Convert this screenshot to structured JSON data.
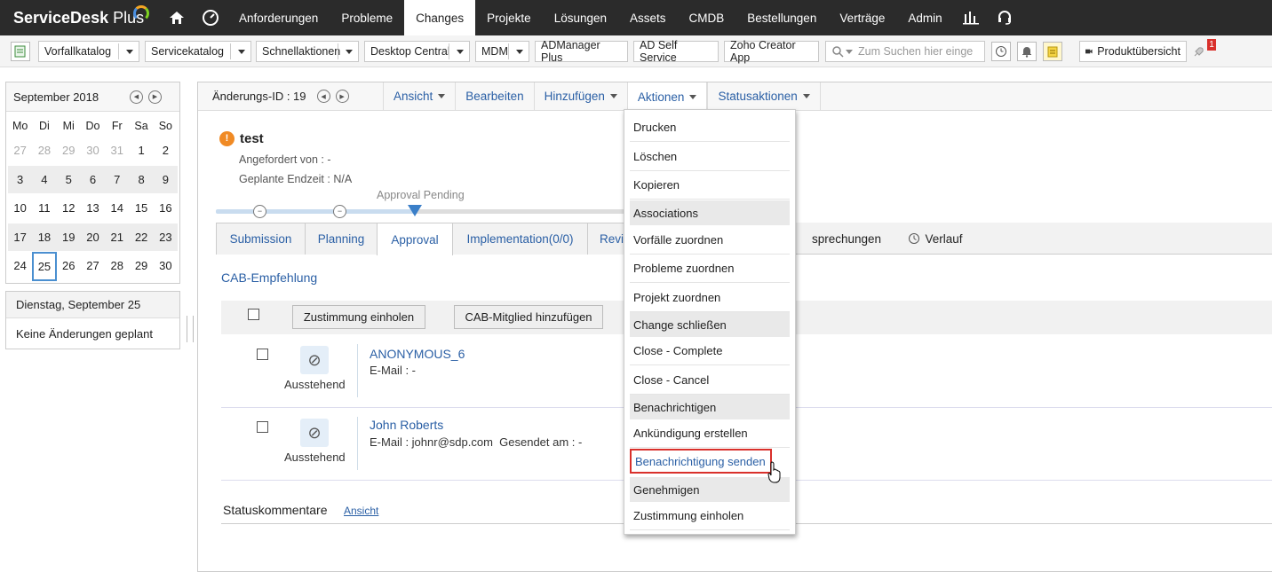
{
  "app": {
    "logo_text": "ServiceDesk",
    "logo_plus": "Plus"
  },
  "topnav": [
    "Anforderungen",
    "Probleme",
    "Changes",
    "Projekte",
    "Lösungen",
    "Assets",
    "CMDB",
    "Bestellungen",
    "Verträge",
    "Admin"
  ],
  "toolbar": {
    "vorfallkatalog": "Vorfallkatalog",
    "servicekatalog": "Servicekatalog",
    "schnellaktionen": "Schnellaktionen",
    "desktop_central": "Desktop Central",
    "mdm": "MDM",
    "admanager": "ADManager Plus",
    "adselfservice": "AD Self Service",
    "zoho": "Zoho Creator App",
    "search_placeholder": "Zum Suchen hier einge",
    "produktuebersicht": "Produktübersicht",
    "badge": "1"
  },
  "calendar": {
    "month": "September 2018",
    "dow": [
      "Mo",
      "Di",
      "Mi",
      "Do",
      "Fr",
      "Sa",
      "So"
    ],
    "weeks": [
      [
        "27",
        "28",
        "29",
        "30",
        "31",
        "1",
        "2"
      ],
      [
        "3",
        "4",
        "5",
        "6",
        "7",
        "8",
        "9"
      ],
      [
        "10",
        "11",
        "12",
        "13",
        "14",
        "15",
        "16"
      ],
      [
        "17",
        "18",
        "19",
        "20",
        "21",
        "22",
        "23"
      ],
      [
        "24",
        "25",
        "26",
        "27",
        "28",
        "29",
        "30"
      ]
    ],
    "selected_date": "Dienstag, September 25",
    "no_changes": "Keine Änderungen geplant"
  },
  "panel": {
    "change_id": "Änderungs-ID : 19",
    "actions": {
      "ansicht": "Ansicht",
      "bearbeiten": "Bearbeiten",
      "hinzufuegen": "Hinzufügen",
      "aktionen": "Aktionen",
      "statusaktionen": "Statusaktionen"
    },
    "title": "test",
    "requested_by": "Angefordert von : -",
    "planned_end": "Geplante Endzeit : N/A",
    "stage": "Approval Pending",
    "tabs": {
      "submission": "Submission",
      "planning": "Planning",
      "approval": "Approval",
      "implementation": "Implementation(0/0)",
      "review": "Revi",
      "besprechungen": "sprechungen",
      "verlauf": "Verlauf"
    },
    "cab_title": "CAB-Empfehlung",
    "btn_approve": "Zustimmung einholen",
    "btn_add_member": "CAB-Mitglied hinzufügen",
    "members": [
      {
        "name": "ANONYMOUS_6",
        "email": "E-Mail : -",
        "sent": "",
        "status": "Ausstehend"
      },
      {
        "name": "John Roberts",
        "email": "E-Mail : johnr@sdp.com",
        "sent": "Gesendet am : -",
        "status": "Ausstehend"
      }
    ],
    "status_comments": "Statuskommentare",
    "status_link": "Ansicht"
  },
  "menu": {
    "drucken": "Drucken",
    "loeschen": "Löschen",
    "kopieren": "Kopieren",
    "associations": "Associations",
    "vorfaelle": "Vorfälle zuordnen",
    "probleme": "Probleme zuordnen",
    "projekt": "Projekt zuordnen",
    "change_close": "Change schließen",
    "close_complete": "Close - Complete",
    "close_cancel": "Close - Cancel",
    "benachrichtigen": "Benachrichtigen",
    "ankuendigung": "Ankündigung erstellen",
    "benachrichtigung": "Benachrichtigung senden",
    "genehmigen": "Genehmigen",
    "zustimmung": "Zustimmung einholen"
  }
}
